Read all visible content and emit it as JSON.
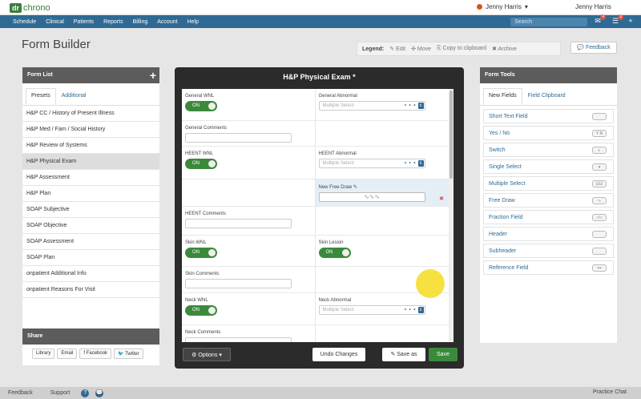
{
  "logo": {
    "dr": "dr",
    "chrono": "chrono"
  },
  "user": {
    "menu_name": "Jenny Harris",
    "name": "Jenny Harris"
  },
  "nav": [
    "Schedule",
    "Clinical",
    "Patients",
    "Reports",
    "Billing",
    "Account",
    "Help"
  ],
  "search": {
    "placeholder": "Search"
  },
  "badges": {
    "messages": "4",
    "tasks": "3"
  },
  "page": {
    "title": "Form Builder"
  },
  "legend": {
    "label": "Legend:",
    "edit": "✎ Edit",
    "move": "✣ Move",
    "copy": "⎘ Copy to clipboard",
    "archive": "✖ Archive"
  },
  "feedback_label": "💬 Feedback",
  "form_list": {
    "title": "Form List",
    "add": "+",
    "tabs": [
      "Presets",
      "Additional"
    ],
    "items": [
      "H&P CC / History of Present Illness",
      "H&P Med / Fam / Social History",
      "H&P Review of Systems",
      "H&P Physical Exam",
      "H&P Assessment",
      "H&P Plan",
      "SOAP Subjective",
      "SOAP Objective",
      "SOAP Assessment",
      "SOAP Plan",
      "onpatient Additional Info",
      "onpatient Reasons For Visit"
    ],
    "selected_index": 3
  },
  "share": {
    "title": "Share",
    "buttons": [
      "Library",
      "Email",
      "f Facebook",
      "🐦 Twitter"
    ]
  },
  "builder": {
    "title": "H&P Physical Exam *",
    "rows": [
      {
        "left": {
          "label": "General WNL",
          "toggle": "ON"
        },
        "right": {
          "label": "General Abnormal",
          "select": "Multiple Select"
        }
      },
      {
        "left": {
          "label": "General Comments"
        }
      },
      {
        "left": {
          "label": "HEENT WNL",
          "toggle": "ON"
        },
        "right": {
          "label": "HEENT Abnormal",
          "select": "Multiple Select"
        }
      },
      {
        "right": {
          "label": "New Free Draw ✎",
          "draw": "∿∿∿"
        }
      },
      {
        "left": {
          "label": "HEENT Comments"
        }
      },
      {
        "left": {
          "label": "Skin WNL",
          "toggle": "ON"
        },
        "right": {
          "label": "Skin Lesion",
          "toggle": "ON"
        }
      },
      {
        "left": {
          "label": "Skin Comments"
        }
      },
      {
        "left": {
          "label": "Neck WNL",
          "toggle": "ON"
        },
        "right": {
          "label": "Neck Abnormal",
          "select": "Multiple Select"
        }
      },
      {
        "left": {
          "label": "Neck Comments"
        }
      }
    ],
    "buttons": {
      "options": "⚙ Options ▾",
      "undo": "Undo Changes",
      "saveas": "✎ Save as",
      "save": "Save"
    }
  },
  "form_tools": {
    "title": "Form Tools",
    "tabs": [
      "New Fields",
      "Field Clipboard"
    ],
    "items": [
      {
        "label": "Short Text Field",
        "icon": ""
      },
      {
        "label": "Yes / No",
        "icon": "Y N"
      },
      {
        "label": "Switch",
        "icon": "◐"
      },
      {
        "label": "Single Select",
        "icon": "▾"
      },
      {
        "label": "Multiple Select",
        "icon": "☑☑"
      },
      {
        "label": "Free Draw",
        "icon": "∿"
      },
      {
        "label": "Fraction Field",
        "icon": "○/○"
      },
      {
        "label": "Header",
        "icon": ""
      },
      {
        "label": "Subheader",
        "icon": ""
      },
      {
        "label": "Reference Field",
        "icon": "•••"
      }
    ]
  },
  "footer": {
    "feedback": "Feedback",
    "support": "Support",
    "help": "?",
    "chat_icon": "💬",
    "chat": "Practice Chat"
  }
}
